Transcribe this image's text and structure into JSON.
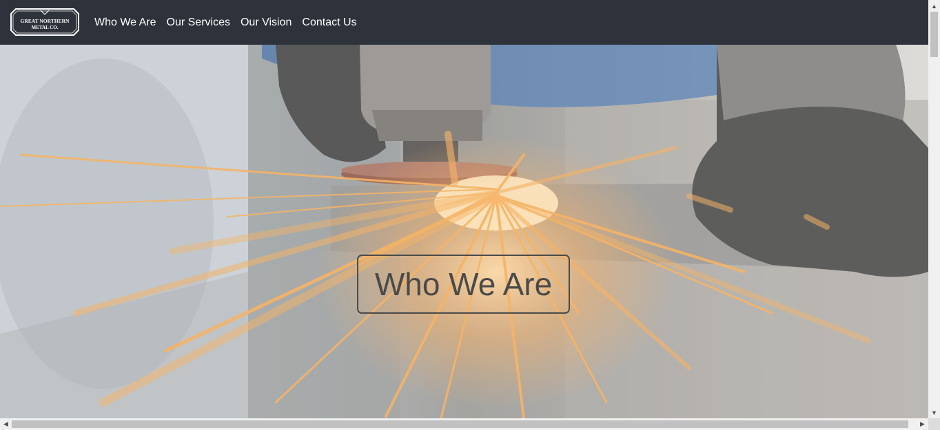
{
  "brand": {
    "logo_line1": "GREAT NORTHERN",
    "logo_line2": "METAL CO.",
    "logo_icon": "crossed-hammers-icon"
  },
  "nav": {
    "items": [
      {
        "label": "Who We Are"
      },
      {
        "label": "Our Services"
      },
      {
        "label": "Our Vision"
      },
      {
        "label": "Contact Us"
      }
    ]
  },
  "hero": {
    "title": "Who We Are",
    "image_subject": "angle grinder sparks photo"
  },
  "scrollbars": {
    "vertical": {
      "up_icon": "▲",
      "down_icon": "▼"
    },
    "horizontal": {
      "left_icon": "◀",
      "right_icon": "▶"
    }
  },
  "colors": {
    "navbar_bg": "#2d323b",
    "nav_text": "#ffffff",
    "hero_title": "#4a4a4a",
    "spark": "#f4a64a"
  }
}
